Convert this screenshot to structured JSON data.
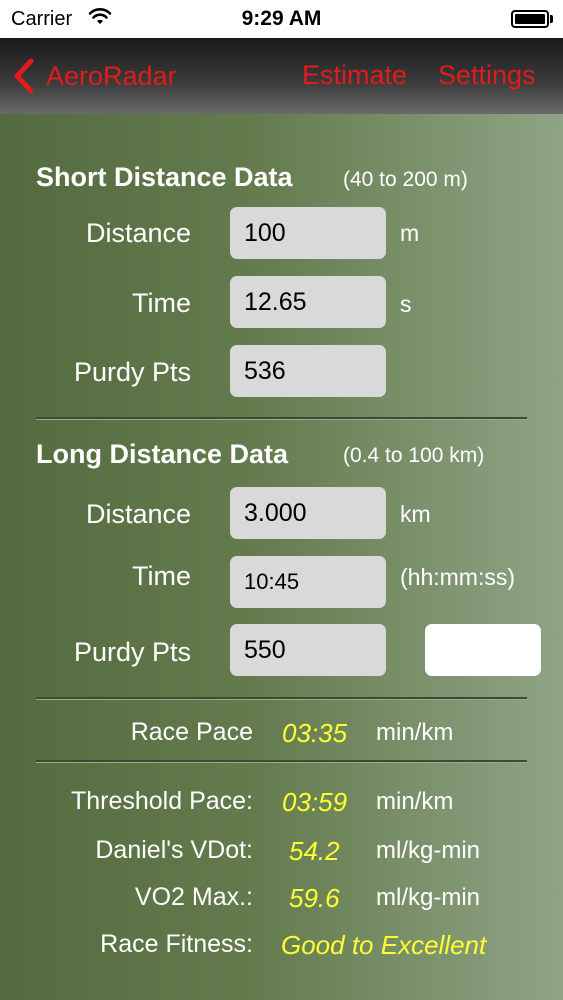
{
  "status_bar": {
    "carrier": "Carrier",
    "time": "9:29 AM"
  },
  "nav": {
    "back_label": "AeroRadar",
    "estimate_label": "Estimate",
    "settings_label": "Settings",
    "accent_color": "#e01c1c"
  },
  "short_distance": {
    "title": "Short Distance Data",
    "range": "(40 to 200 m)",
    "distance": {
      "label": "Distance",
      "value": "100",
      "unit": "m"
    },
    "time": {
      "label": "Time",
      "value": "12.65",
      "unit": "s"
    },
    "purdy": {
      "label": "Purdy Pts",
      "value": "536"
    }
  },
  "long_distance": {
    "title": "Long Distance Data",
    "range": "(0.4 to 100 km)",
    "distance": {
      "label": "Distance",
      "value": "3.000",
      "unit": "km"
    },
    "time": {
      "label": "Time",
      "value": "10:45",
      "unit": "(hh:mm:ss)"
    },
    "purdy": {
      "label": "Purdy Pts",
      "value": "550"
    }
  },
  "results": {
    "race_pace": {
      "label": "Race Pace",
      "value": "03:35",
      "unit": "min/km"
    },
    "threshold_pace": {
      "label": "Threshold Pace:",
      "value": "03:59",
      "unit": "min/km"
    },
    "vdot": {
      "label": "Daniel's VDot:",
      "value": "54.2",
      "unit": "ml/kg-min"
    },
    "vo2max": {
      "label": "VO2 Max.:",
      "value": "59.6",
      "unit": "ml/kg-min"
    },
    "race_fitness": {
      "label": "Race Fitness:",
      "value": "Good to Excellent"
    },
    "value_color": "#ffff33"
  }
}
